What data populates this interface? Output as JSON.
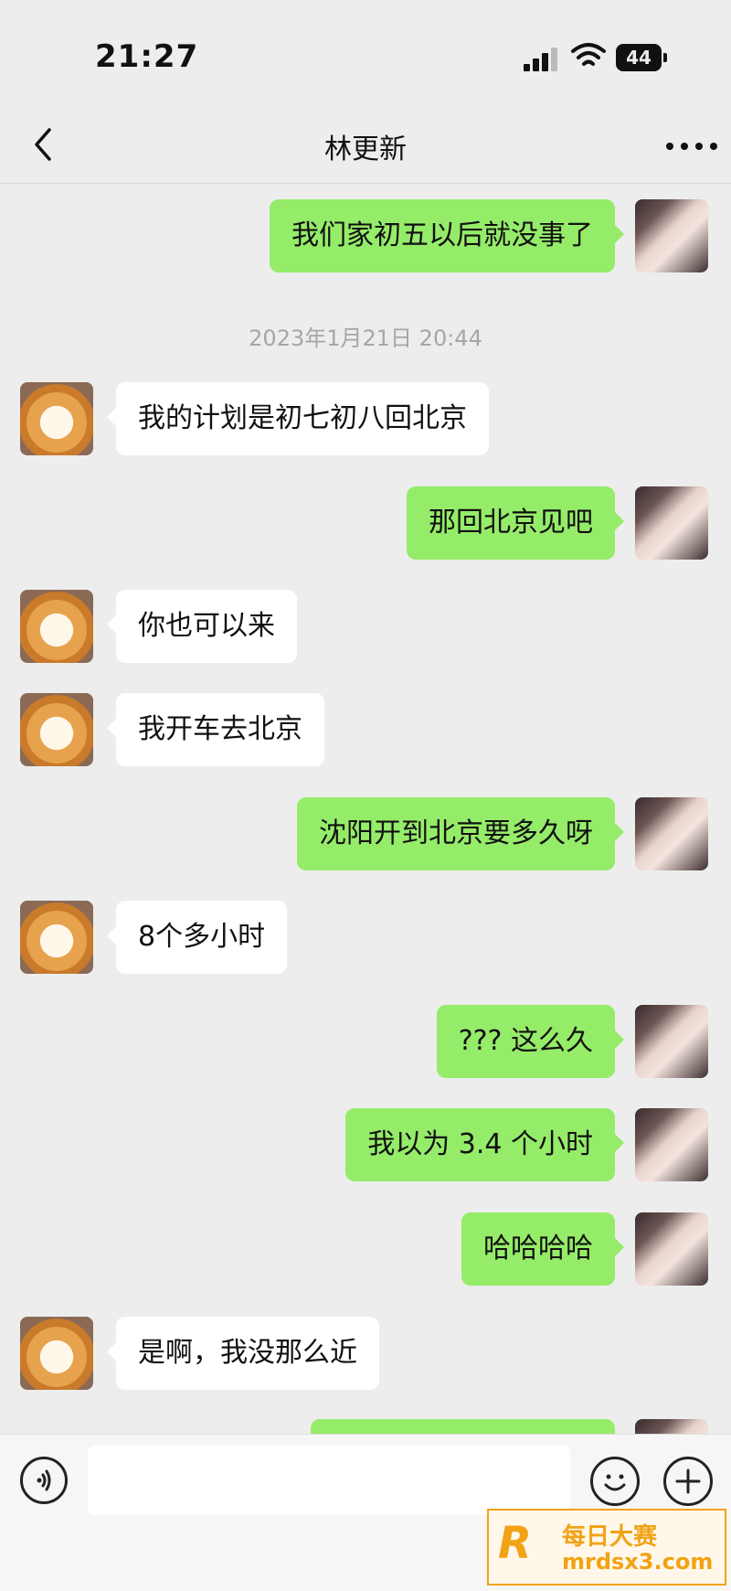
{
  "status_bar": {
    "time": "21:27",
    "battery": "44"
  },
  "nav": {
    "title": "林更新"
  },
  "timestamp": "2023年1月21日 20:44",
  "messages": [
    {
      "side": "out",
      "text": "我们家初五以后就没事了"
    },
    {
      "side": "in",
      "text": "我的计划是初七初八回北京"
    },
    {
      "side": "out",
      "text": "那回北京见吧"
    },
    {
      "side": "in",
      "text": "你也可以来"
    },
    {
      "side": "in",
      "text": "我开车去北京"
    },
    {
      "side": "out",
      "text": "沈阳开到北京要多久呀"
    },
    {
      "side": "in",
      "text": "8个多小时"
    },
    {
      "side": "out",
      "text": "??? 这么久"
    },
    {
      "side": "out",
      "text": "我以为 3.4 个小时"
    },
    {
      "side": "out",
      "text": "哈哈哈哈"
    },
    {
      "side": "in",
      "text": "是啊，我没那么近"
    }
  ],
  "input": {
    "placeholder": ""
  },
  "watermark": {
    "logo": "R",
    "line1": "每日大赛",
    "line2": "mrdsx3.com"
  },
  "colors": {
    "out_bubble": "#95ec69",
    "in_bubble": "#ffffff",
    "background": "#ededed"
  }
}
